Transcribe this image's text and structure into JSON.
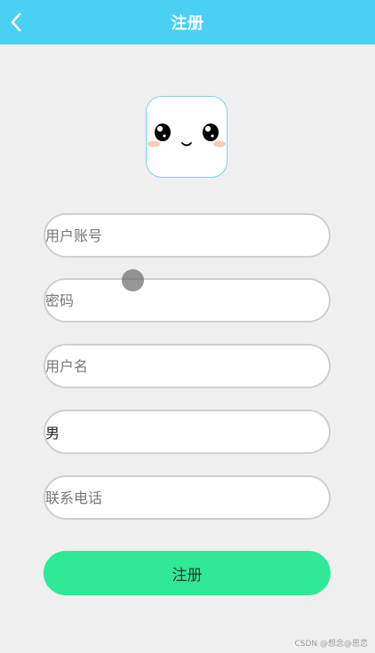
{
  "header": {
    "title": "注册",
    "back_icon": "chevron-left-icon"
  },
  "avatar": {
    "icon": "kawaii-face-icon"
  },
  "form": {
    "account_placeholder": "用户账号",
    "password_placeholder": "密码",
    "username_placeholder": "用户名",
    "gender_value": "男",
    "phone_placeholder": "联系电话",
    "submit_label": "注册"
  },
  "footer": {
    "watermark": "CSDN @想念@思恋"
  },
  "colors": {
    "header_bg": "#49d0f2",
    "page_bg": "#efefef",
    "submit_bg": "#2fe997",
    "field_border": "#cfcfcf"
  }
}
